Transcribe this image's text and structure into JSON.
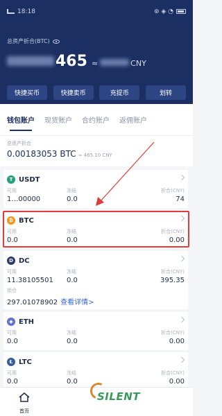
{
  "status_bar": {
    "time": "18:18",
    "carrier": "ul ull",
    "right": "⊛ ◈ ◔"
  },
  "header": {
    "total_label": "总资产折合(BTC)",
    "total_amount": "465",
    "approx": "≈",
    "currency": "CNY",
    "buttons": [
      "快捷买币",
      "快捷卖币",
      "充提币",
      "划转"
    ]
  },
  "tabs": [
    {
      "label": "钱包账户",
      "active": true
    },
    {
      "label": "现货账户",
      "active": false
    },
    {
      "label": "合约账户",
      "active": false
    },
    {
      "label": "返佣账户",
      "active": false
    }
  ],
  "summary": {
    "label": "总资产折合",
    "value": "0.00183053 BTC",
    "approx": "≈ 465.10 CNY"
  },
  "column_labels": {
    "available": "可用",
    "frozen": "冻结",
    "cny": "折合(CNY)"
  },
  "coins": [
    {
      "name": "USDT",
      "icon": "T",
      "color": "#26a17b",
      "available": "1…00000",
      "frozen": "0.0",
      "cny": "74"
    },
    {
      "name": "BTC",
      "icon": "₿",
      "color": "#f7931a",
      "available": "0.0",
      "frozen": "0.0",
      "cny": "0.00"
    },
    {
      "name": "DC",
      "icon": "D",
      "color": "#2e3a6b",
      "available": "11.38105501",
      "frozen": "0.0",
      "cny": "395.35",
      "locked_label": "锁仓",
      "locked": "297.01078902",
      "detail_link": "查看详情>"
    },
    {
      "name": "ETH",
      "icon": "◆",
      "color": "#6270d6",
      "available": "0.0",
      "frozen": "0.0",
      "cny": "0.00"
    },
    {
      "name": "LTC",
      "icon": "Ł",
      "color": "#345d9d",
      "available": "0.0",
      "frozen": "0.0",
      "cny": "0.00"
    }
  ],
  "bottom_nav": {
    "home": "首页"
  },
  "watermark": "SILENT"
}
